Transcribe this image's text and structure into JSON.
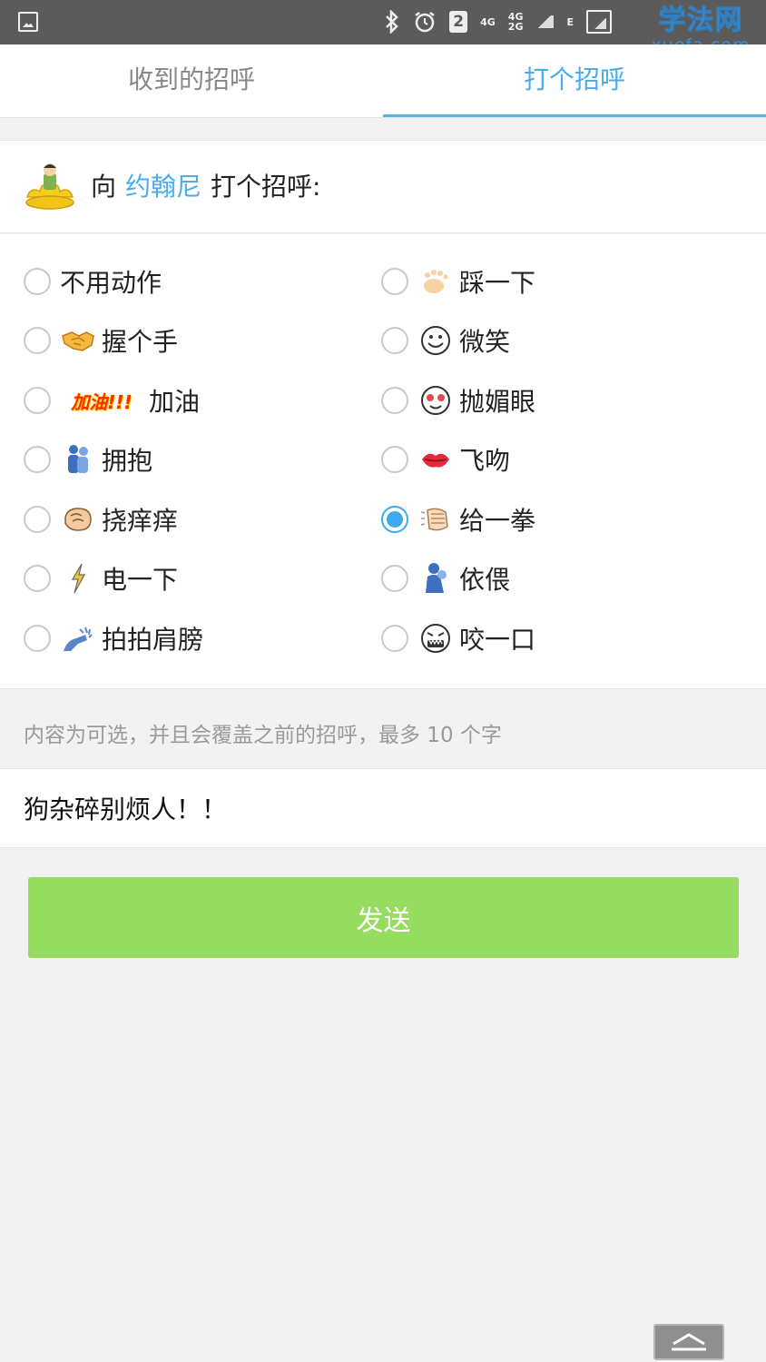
{
  "status_bar": {
    "sim_slot": "2",
    "net1": "4G",
    "net2_top": "4G",
    "net2_bottom": "2G",
    "net3": "E",
    "watermark_main": "学法网",
    "watermark_sub": "xuefa.com"
  },
  "tabs": [
    {
      "label": "收到的招呼",
      "active": false
    },
    {
      "label": "打个招呼",
      "active": true
    }
  ],
  "greet": {
    "prefix": "向",
    "username": "约翰尼",
    "suffix": "打个招呼:"
  },
  "options": {
    "left": [
      {
        "label": "不用动作",
        "icon": null,
        "checked": false
      },
      {
        "label": "握个手",
        "icon": "handshake-icon",
        "checked": false
      },
      {
        "label": "加油",
        "icon": "cheer-icon",
        "icon_text": "加油!!!",
        "checked": false
      },
      {
        "label": "拥抱",
        "icon": "hug-icon",
        "checked": false
      },
      {
        "label": "挠痒痒",
        "icon": "tickle-icon",
        "checked": false
      },
      {
        "label": "电一下",
        "icon": "lightning-icon",
        "checked": false
      },
      {
        "label": "拍拍肩膀",
        "icon": "pat-shoulder-icon",
        "checked": false
      }
    ],
    "right": [
      {
        "label": "踩一下",
        "icon": "footprint-icon",
        "checked": false
      },
      {
        "label": "微笑",
        "icon": "smile-icon",
        "checked": false
      },
      {
        "label": "抛媚眼",
        "icon": "wink-icon",
        "checked": false
      },
      {
        "label": "飞吻",
        "icon": "kiss-icon",
        "checked": false
      },
      {
        "label": "给一拳",
        "icon": "punch-icon",
        "checked": true
      },
      {
        "label": "依偎",
        "icon": "snuggle-icon",
        "checked": false
      },
      {
        "label": "咬一口",
        "icon": "bite-icon",
        "checked": false
      }
    ]
  },
  "hint": "内容为可选，并且会覆盖之前的招呼，最多 10 个字",
  "message": {
    "value": "狗杂碎别烦人！！"
  },
  "send_label": "发送",
  "colors": {
    "accent": "#4aacea",
    "send_button": "#96dc5e",
    "status_bar": "#5b5b5b",
    "background": "#f2f2f2"
  }
}
